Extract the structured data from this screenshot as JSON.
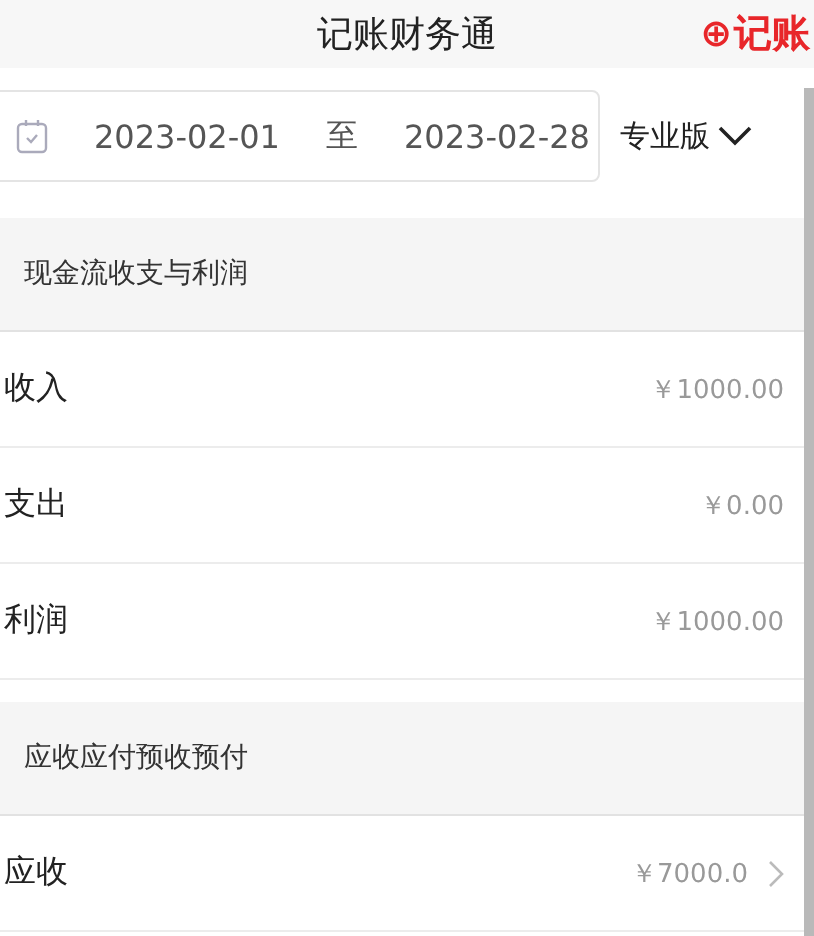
{
  "header": {
    "title": "记账财务通",
    "action": {
      "icon": "⊕",
      "label": "记账"
    }
  },
  "filter": {
    "start_date": "2023-02-01",
    "separator": "至",
    "end_date": "2023-02-28",
    "edition": "专业版"
  },
  "sections": [
    {
      "title": "现金流收支与利润",
      "rows": [
        {
          "label": "收入",
          "amount": "￥1000.00",
          "kind": "plain"
        },
        {
          "label": "支出",
          "amount": "￥0.00",
          "kind": "plain"
        },
        {
          "label": "利润",
          "amount": "￥1000.00",
          "kind": "plain"
        }
      ]
    },
    {
      "title": "应收应付预收预付",
      "rows": [
        {
          "label": "应收",
          "amount": "￥7000.0",
          "kind": "link"
        }
      ]
    }
  ]
}
